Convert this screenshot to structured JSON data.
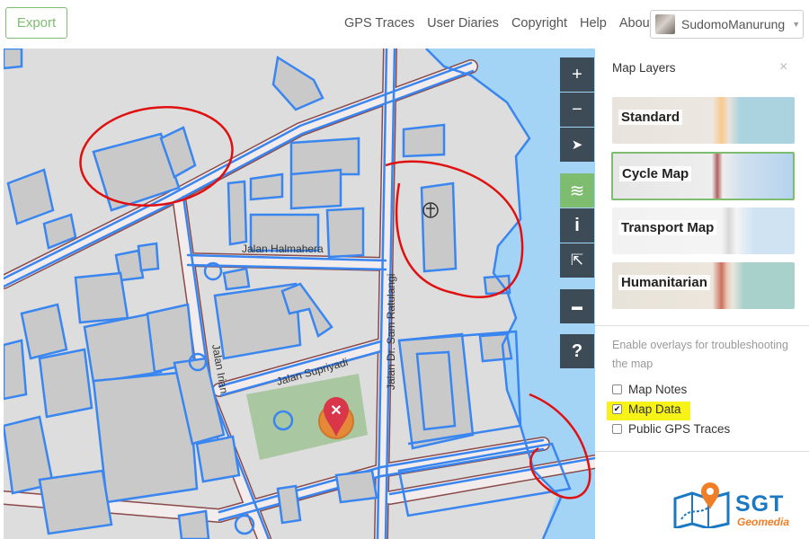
{
  "topbar": {
    "export_label": "Export",
    "nav": [
      "GPS Traces",
      "User Diaries",
      "Copyright",
      "Help",
      "About"
    ],
    "username": "SudomoManurung",
    "user_caret": "▼"
  },
  "map": {
    "street_labels": [
      "Jalan Halmahera",
      "Jalan Supriyadi",
      "Jalan Irian",
      "Jalan Dr. Sam Ratulangi"
    ],
    "controls": {
      "zoom_in": "+",
      "zoom_out": "−",
      "locate": "➤",
      "layers": "≋",
      "info": "i",
      "share": "⇱",
      "note": "▬",
      "help": "?"
    }
  },
  "panel": {
    "title": "Map Layers",
    "close": "×",
    "layers": [
      {
        "name": "Standard",
        "selected": false
      },
      {
        "name": "Cycle Map",
        "selected": true
      },
      {
        "name": "Transport Map",
        "selected": false
      },
      {
        "name": "Humanitarian",
        "selected": false
      }
    ],
    "overlay_text": "Enable overlays for troubleshooting the map",
    "overlays": [
      {
        "label": "Map Notes",
        "checked": false
      },
      {
        "label": "Map Data",
        "checked": true,
        "highlight": "#f7f318"
      },
      {
        "label": "Public GPS Traces",
        "checked": false
      }
    ],
    "check_glyph": "✔"
  },
  "logo": {
    "brand": "SGT",
    "sub": "Geomedia"
  },
  "colors": {
    "accent": "#7ebc6f",
    "control": "#3d4b57",
    "data_outline": "#3a86f0",
    "annotation": "#e01010",
    "water": "#a4d4f5"
  }
}
